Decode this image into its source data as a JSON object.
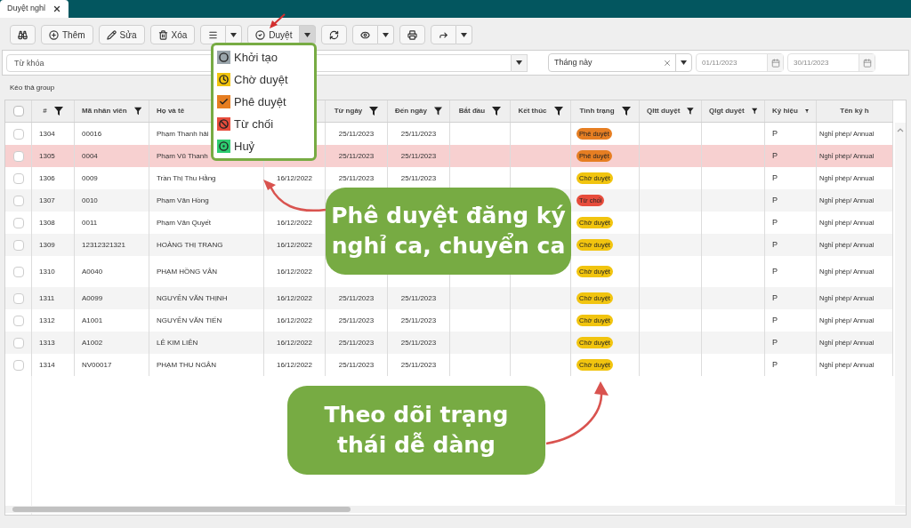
{
  "tab": {
    "title": "Duyệt nghỉ"
  },
  "toolbar": {
    "buttons": [
      {
        "kind": "search"
      },
      {
        "kind": "add",
        "label": "Thêm"
      },
      {
        "kind": "edit",
        "label": "Sửa"
      },
      {
        "kind": "delete",
        "label": "Xóa"
      },
      {
        "kind": "menu",
        "caret": true,
        "expanded": false
      },
      {
        "kind": "approve",
        "label": "Duyệt",
        "caret": true,
        "expanded": true
      },
      {
        "kind": "refresh"
      },
      {
        "kind": "view",
        "caret": true,
        "expanded": false
      },
      {
        "kind": "print"
      },
      {
        "kind": "share",
        "caret": true,
        "expanded": false
      }
    ]
  },
  "status_menu": {
    "items": [
      {
        "kind": "new",
        "label": "Khởi tạo"
      },
      {
        "kind": "pending",
        "label": "Chờ duyệt"
      },
      {
        "kind": "approved",
        "label": "Phê duyệt"
      },
      {
        "kind": "rejected",
        "label": "Từ chối"
      },
      {
        "kind": "cancelled",
        "label": "Huỷ"
      }
    ]
  },
  "filters": {
    "keyword": {
      "placeholder": "Từ khóa"
    },
    "period": {
      "value": "Tháng này"
    },
    "date_from": {
      "value": "01/11/2023",
      "disabled": true
    },
    "date_to": {
      "value": "30/11/2023",
      "disabled": true
    }
  },
  "group_hint": "Kéo thả group",
  "table": {
    "all_checked": false,
    "columns": [
      {
        "label": "#",
        "filter": true
      },
      {
        "label": "Mã nhân viên",
        "filter": true
      },
      {
        "label": "Họ và tê",
        "filter": false
      },
      {},
      {
        "label": "Từ ngày",
        "filter": true
      },
      {
        "label": "Đến ngày",
        "filter": true
      },
      {
        "label": "Bắt đầu",
        "filter": true
      },
      {
        "label": "Kết thúc",
        "filter": true
      },
      {
        "label": "Tình trạng",
        "filter": true
      },
      {
        "label": "Qltt duyệt",
        "filter": true
      },
      {
        "label": "Qlgt duyệt",
        "filter": true
      },
      {
        "label": "Ký hiệu",
        "filter": true
      },
      {
        "label": "Tên ký h",
        "filter": false
      }
    ],
    "rows": [
      {
        "checked": false,
        "selected": false,
        "id": "1304",
        "code": "00016",
        "name": "Phạm Thanh hải",
        "from": "25/11/2023",
        "to": "25/11/2023",
        "status": {
          "kind": "approved",
          "label": "Phê duyệt"
        },
        "symbol": "P",
        "type": "Nghỉ phép/ Annual"
      },
      {
        "checked": false,
        "selected": true,
        "id": "1305",
        "code": "0004",
        "name": "Phạm Vũ Thanh",
        "from": "25/11/2023",
        "to": "25/11/2023",
        "status": {
          "kind": "approved",
          "label": "Phê duyệt"
        },
        "symbol": "P",
        "type": "Nghỉ phép/ Annual"
      },
      {
        "checked": false,
        "selected": false,
        "id": "1306",
        "code": "0009",
        "name": "Trần Thị Thu Hằng",
        "created": "16/12/2022",
        "from": "25/11/2023",
        "to": "25/11/2023",
        "status": {
          "kind": "pending",
          "label": "Chờ duyệt"
        },
        "symbol": "P",
        "type": "Nghỉ phép/ Annual"
      },
      {
        "checked": false,
        "selected": false,
        "id": "1307",
        "code": "0010",
        "name": "Phạm Văn Hồng",
        "status": {
          "kind": "rejected",
          "label": "Từ chối"
        },
        "symbol": "P",
        "type": "Nghỉ phép/ Annual"
      },
      {
        "checked": false,
        "selected": false,
        "id": "1308",
        "code": "0011",
        "name": "Phạm Văn Quyết",
        "created": "16/12/2022",
        "status": {
          "kind": "pending",
          "label": "Chờ duyệt"
        },
        "symbol": "P",
        "type": "Nghỉ phép/ Annual"
      },
      {
        "checked": false,
        "selected": false,
        "id": "1309",
        "code": "12312321321",
        "name": "HOÀNG THỊ TRANG",
        "created": "16/12/2022",
        "status": {
          "kind": "pending",
          "label": "Chờ duyệt"
        },
        "symbol": "P",
        "type": "Nghỉ phép/ Annual"
      },
      {
        "checked": false,
        "selected": false,
        "id": "1310",
        "code": "A0040",
        "name": "PHẠM HỒNG VÂN",
        "created": "16/12/2022",
        "status": {
          "kind": "pending",
          "label": "Chờ duyệt"
        },
        "symbol": "P",
        "type": "Nghỉ phép/ Annual"
      },
      {
        "checked": false,
        "selected": false,
        "id": "1311",
        "code": "A0099",
        "name": "NGUYỄN VĂN THỊNH",
        "created": "16/12/2022",
        "from": "25/11/2023",
        "to": "25/11/2023",
        "status": {
          "kind": "pending",
          "label": "Chờ duyệt"
        },
        "symbol": "P",
        "type": "Nghỉ phép/ Annual"
      },
      {
        "checked": false,
        "selected": false,
        "id": "1312",
        "code": "A1001",
        "name": "NGUYỄN VĂN TIẾN",
        "created": "16/12/2022",
        "from": "25/11/2023",
        "to": "25/11/2023",
        "status": {
          "kind": "pending",
          "label": "Chờ duyệt"
        },
        "symbol": "P",
        "type": "Nghỉ phép/ Annual"
      },
      {
        "checked": false,
        "selected": false,
        "id": "1313",
        "code": "A1002",
        "name": "LÊ KIM LIÊN",
        "created": "16/12/2022",
        "from": "25/11/2023",
        "to": "25/11/2023",
        "status": {
          "kind": "pending",
          "label": "Chờ duyệt"
        },
        "symbol": "P",
        "type": "Nghỉ phép/ Annual"
      },
      {
        "checked": false,
        "selected": false,
        "id": "1314",
        "code": "NV00017",
        "name": "PHẠM THU NGÂN",
        "created": "16/12/2022",
        "from": "25/11/2023",
        "to": "25/11/2023",
        "status": {
          "kind": "pending",
          "label": "Chờ duyệt"
        },
        "symbol": "P",
        "type": "Nghỉ phép/ Annual"
      }
    ]
  },
  "callouts": [
    {
      "text": "Phê duyệt đăng ký nghỉ ca, chuyển ca"
    },
    {
      "text": "Theo dõi trạng thái dễ dàng"
    }
  ]
}
